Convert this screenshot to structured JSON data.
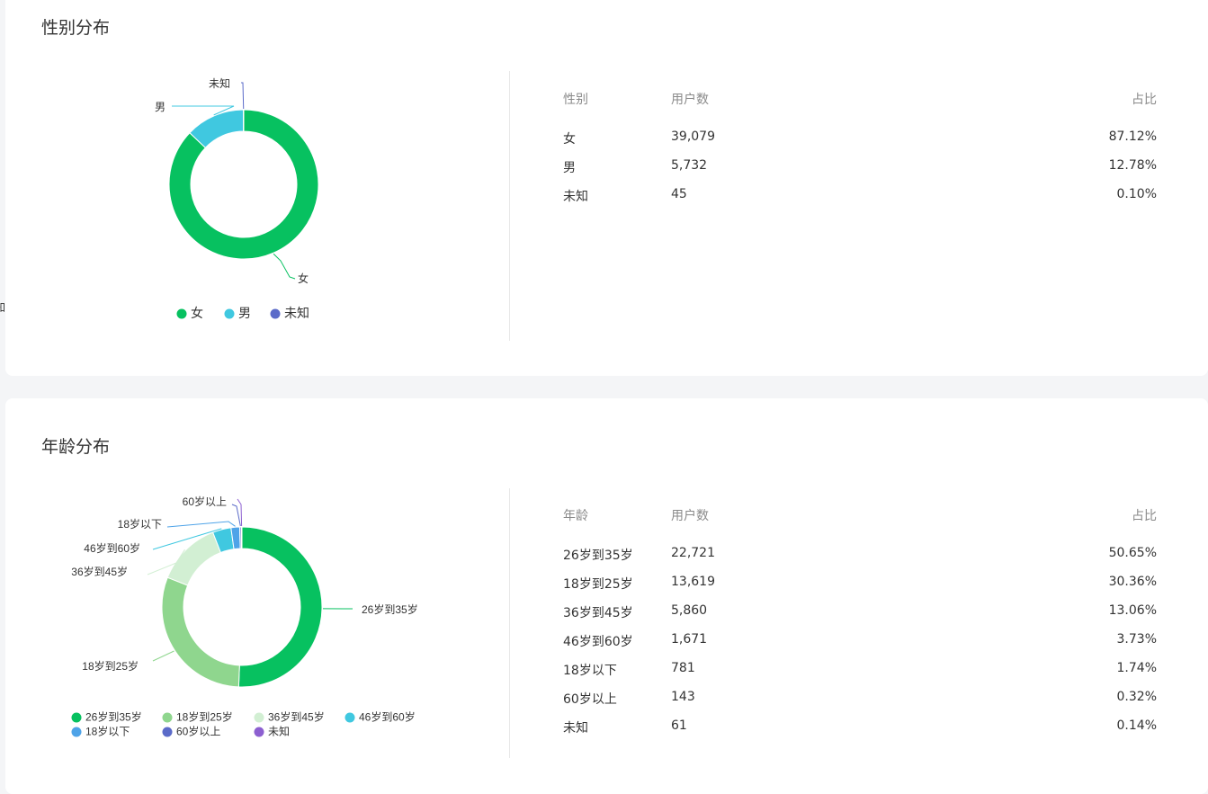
{
  "gender": {
    "title": "性别分布",
    "table": {
      "headers": [
        "性别",
        "用户数",
        "占比"
      ],
      "rows": [
        [
          "女",
          "39,079",
          "87.12%"
        ],
        [
          "男",
          "5,732",
          "12.78%"
        ],
        [
          "未知",
          "45",
          "0.10%"
        ]
      ]
    }
  },
  "age": {
    "title": "年龄分布",
    "table": {
      "headers": [
        "年龄",
        "用户数",
        "占比"
      ],
      "rows": [
        [
          "26岁到35岁",
          "22,721",
          "50.65%"
        ],
        [
          "18岁到25岁",
          "13,619",
          "30.36%"
        ],
        [
          "36岁到45岁",
          "5,860",
          "13.06%"
        ],
        [
          "46岁到60岁",
          "1,671",
          "3.73%"
        ],
        [
          "18岁以下",
          "781",
          "1.74%"
        ],
        [
          "60岁以上",
          "143",
          "0.32%"
        ],
        [
          "未知",
          "61",
          "0.14%"
        ]
      ]
    }
  },
  "chart_data": [
    {
      "type": "pie",
      "variant": "donut",
      "categories": [
        "女",
        "男",
        "未知"
      ],
      "values": [
        39079,
        5732,
        45
      ],
      "colors": [
        "#07c160",
        "#40c8e0",
        "#5b6bc9"
      ],
      "legend": "bottom"
    },
    {
      "type": "pie",
      "variant": "donut",
      "categories": [
        "26岁到35岁",
        "18岁到25岁",
        "36岁到45岁",
        "46岁到60岁",
        "18岁以下",
        "60岁以上",
        "未知"
      ],
      "values": [
        22721,
        13619,
        5860,
        1671,
        781,
        143,
        61
      ],
      "colors": [
        "#07c160",
        "#8fd68e",
        "#d2efd3",
        "#40c8e0",
        "#4ea3e8",
        "#5b6bc9",
        "#8c5fd0"
      ],
      "legend": "bottom"
    }
  ]
}
